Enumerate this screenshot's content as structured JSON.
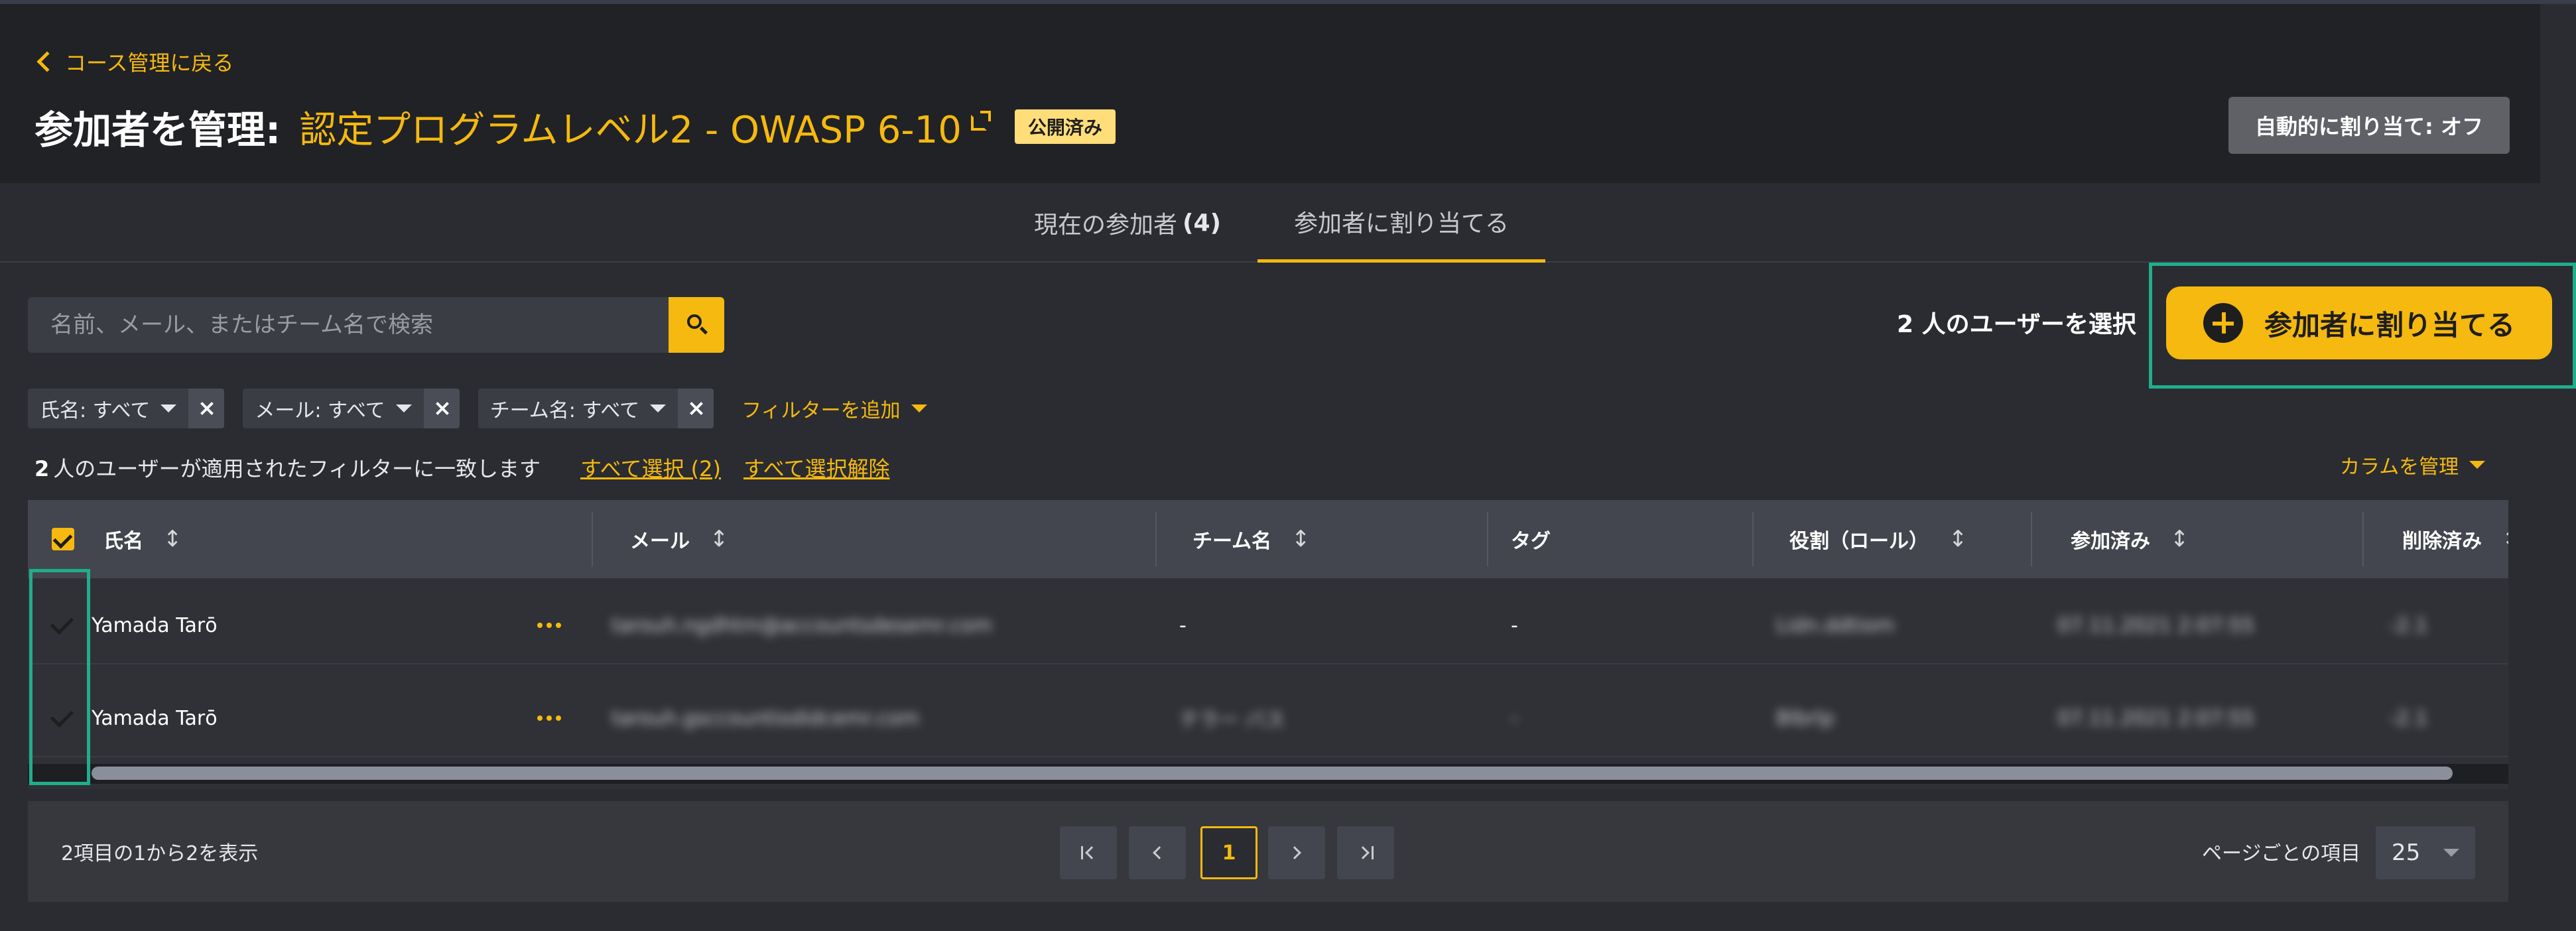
{
  "header": {
    "back_label": "コース管理に戻る",
    "title_label": "参加者を管理:",
    "course_name": "認定プログラムレベル2 - OWASP 6-10",
    "status_badge": "公開済み",
    "auto_assign_label": "自動的に割り当て: オフ"
  },
  "tabs": [
    {
      "label": "現在の参加者",
      "count": "(4)"
    },
    {
      "label": "参加者に割り当てる",
      "active": true
    }
  ],
  "search": {
    "placeholder": "名前、メール、またはチーム名で検索"
  },
  "selection": {
    "selected_text": "2 人のユーザーを選択",
    "assign_button": "参加者に割り当てる"
  },
  "filters": [
    {
      "label": "氏名: すべて"
    },
    {
      "label": "メール: すべて"
    },
    {
      "label": "チーム名: すべて"
    }
  ],
  "add_filter_label": "フィルターを追加",
  "match": {
    "count": "2",
    "text": "人のユーザーが適用されたフィルターに一致します",
    "select_all": "すべて選択 (2)",
    "deselect_all": "すべて選択解除"
  },
  "manage_columns_label": "カラムを管理",
  "table": {
    "columns": [
      "氏名",
      "メール",
      "チーム名",
      "タグ",
      "役割（ロール）",
      "参加済み",
      "削除済み"
    ],
    "rows": [
      {
        "name": "Yamada Tarō",
        "email": "tarouh.ngdhtm@accountsdesemr.com",
        "team": "-",
        "tag": "-",
        "role": "Lidn.ddtiom",
        "joined": "07.11.2021 2:07:55",
        "deleted": "-2.1"
      },
      {
        "name": "Yamada Tarō",
        "email": "tarouh.gsccountiodidcemr.com",
        "team": "テラー バス",
        "tag": "-",
        "role": "Blbrlp",
        "joined": "07.11.2021 2:07:55",
        "deleted": "-2.1"
      }
    ],
    "scroll_fraction": 0.95
  },
  "pagination": {
    "showing": "2項目の1から2を表示",
    "current_page": "1",
    "per_page_label": "ページごとの項目",
    "per_page_value": "25"
  },
  "colors": {
    "accent": "#f5b90f",
    "highlight": "#1fae8c",
    "header_bg": "#212226",
    "page_bg": "#2a2c31"
  }
}
